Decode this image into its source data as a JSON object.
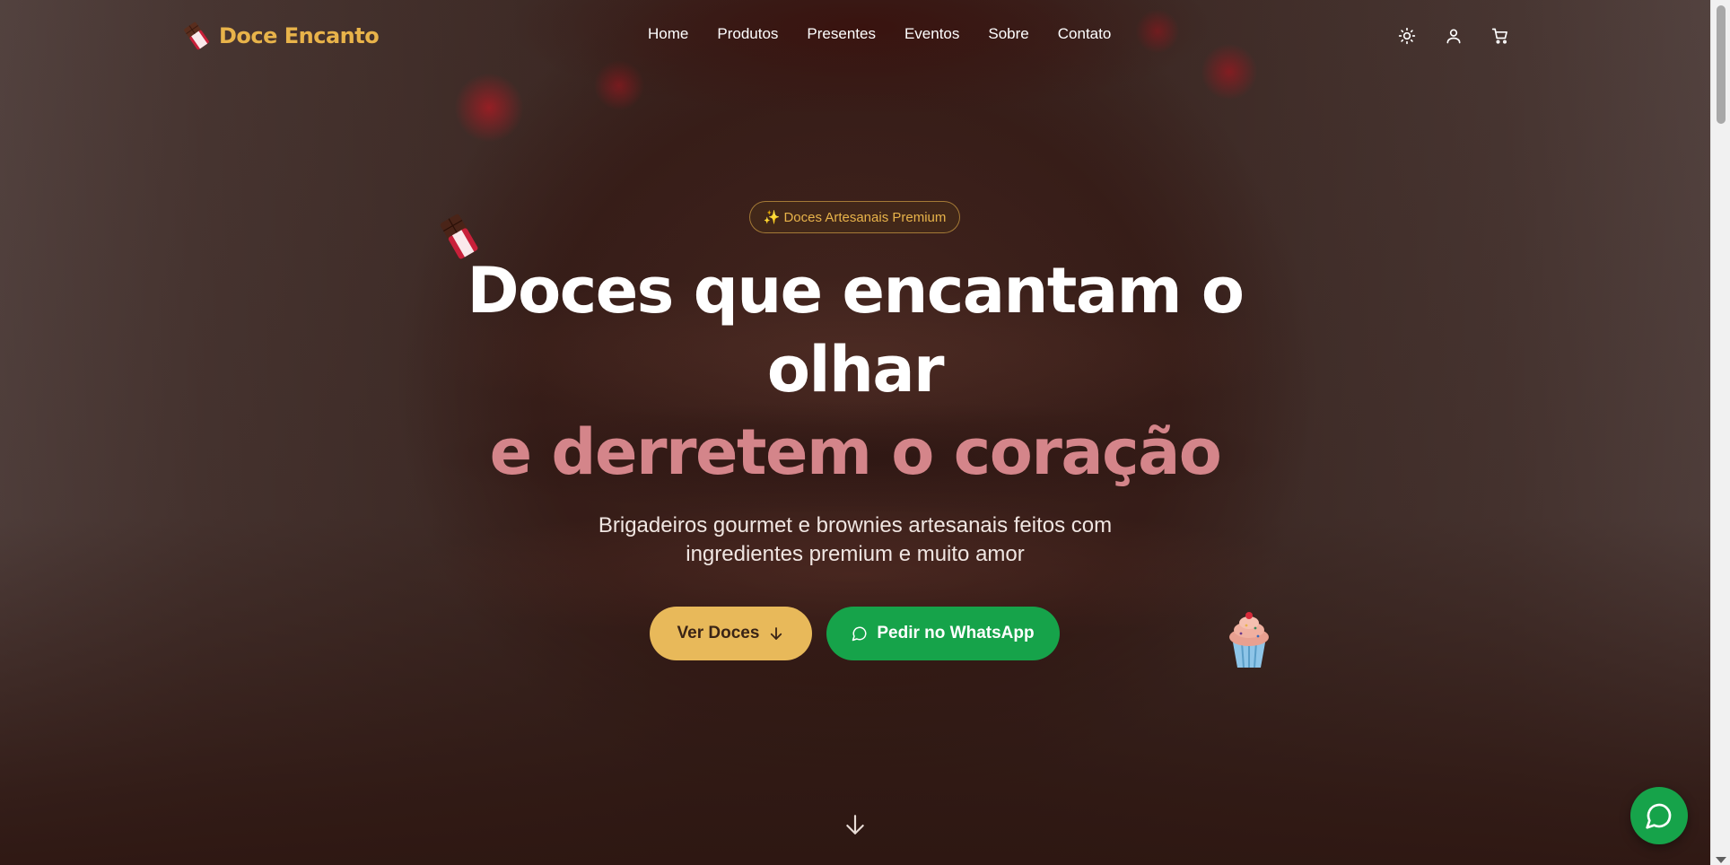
{
  "header": {
    "brand": "Doce Encanto",
    "nav": [
      {
        "label": "Home"
      },
      {
        "label": "Produtos"
      },
      {
        "label": "Presentes"
      },
      {
        "label": "Eventos"
      },
      {
        "label": "Sobre"
      },
      {
        "label": "Contato"
      }
    ],
    "icons": [
      "sun-icon",
      "user-icon",
      "cart-icon"
    ]
  },
  "hero": {
    "badge": "✨ Doces Artesanais Premium",
    "headline_line1": "Doces que encantam o",
    "headline_line2": "olhar",
    "headline_accent": "e derretem o coração",
    "subtitle_line1": "Brigadeiros gourmet e brownies artesanais feitos com",
    "subtitle_line2": "ingredientes premium e muito amor",
    "primary_button": "Ver Doces",
    "whatsapp_button": "Pedir no WhatsApp"
  },
  "colors": {
    "brand_gold": "#e8b34a",
    "accent_pink": "#d4858a",
    "whatsapp_green": "#16a34a",
    "button_gold": "#e8b95a"
  }
}
